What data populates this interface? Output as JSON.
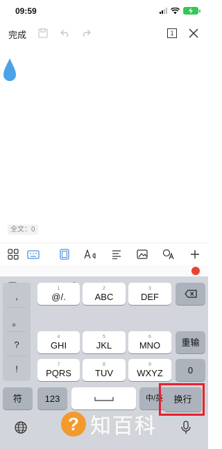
{
  "status": {
    "time": "09:59"
  },
  "topbar": {
    "done_label": "完成",
    "page_count": "1"
  },
  "editor": {
    "word_count": "全文：0"
  },
  "keyboard": {
    "punct": [
      ",",
      "。",
      "?",
      "!"
    ],
    "rows": [
      [
        {
          "small": "1",
          "main": "@/."
        },
        {
          "small": "2",
          "main": "ABC"
        },
        {
          "small": "3",
          "main": "DEF"
        }
      ],
      [
        {
          "small": "4",
          "main": "GHI"
        },
        {
          "small": "5",
          "main": "JKL"
        },
        {
          "small": "6",
          "main": "MNO"
        }
      ],
      [
        {
          "small": "7",
          "main": "PQRS"
        },
        {
          "small": "8",
          "main": "TUV"
        },
        {
          "small": "9",
          "main": "WXYZ"
        }
      ]
    ],
    "rebreak": "重输",
    "zero": "0",
    "symbol": "符",
    "num": "123",
    "lang": "中/英",
    "enter": "换行"
  },
  "watermark": {
    "icon": "?",
    "text": "知百科"
  },
  "colors": {
    "accent": "#4a90e2",
    "highlight": "#e8202f",
    "watermark": "#f7941e"
  }
}
